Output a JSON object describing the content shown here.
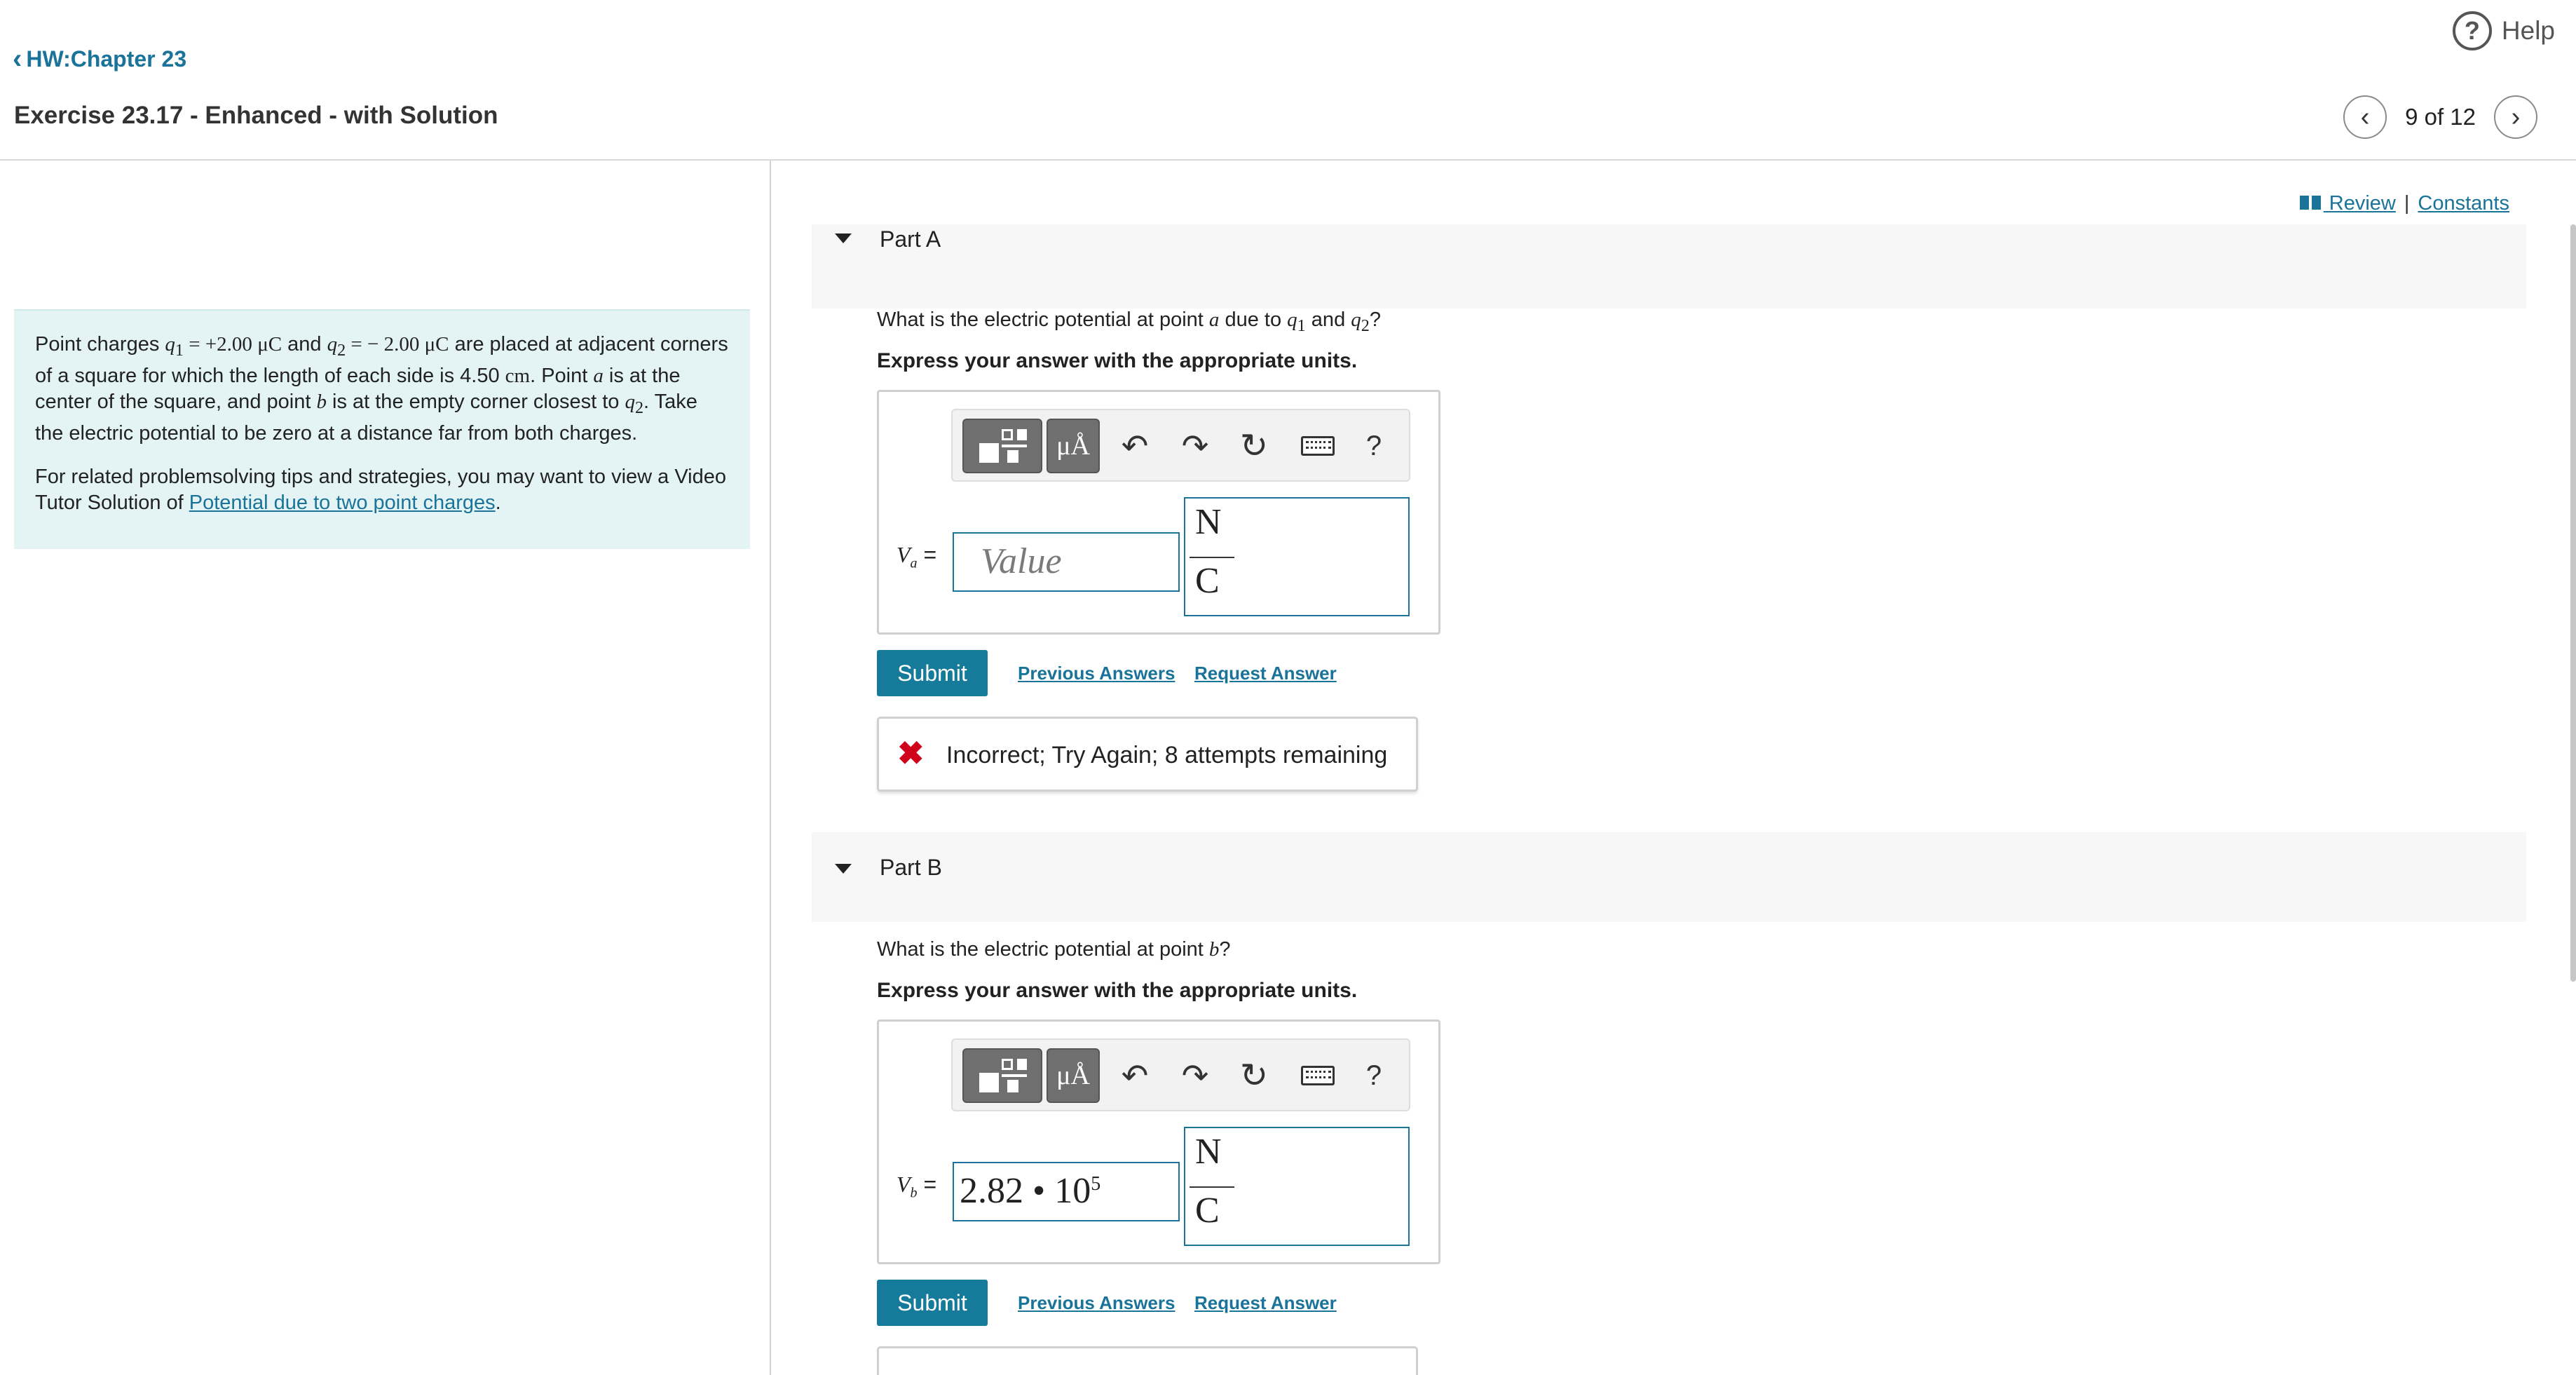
{
  "header": {
    "help_label": "Help",
    "help_icon": "?",
    "back_label": "HW:Chapter 23",
    "title": "Exercise 23.17 - Enhanced - with Solution",
    "pager": "9 of 12",
    "prev_icon": "‹",
    "next_icon": "›"
  },
  "problem": {
    "intro_1": "Point charges ",
    "q1_sym": "q",
    "q1_sub": "1",
    "q1_val": " = +2.00 ",
    "unit_mu": "μC",
    "and": " and ",
    "q2_sym": "q",
    "q2_sub": "2",
    "q2_val": " = − 2.00 ",
    "intro_2": " are placed at adjacent corners of a square for which the length of each side is 4.50 ",
    "cm": "cm",
    "intro_3": ". Point ",
    "a": "a",
    "intro_4": " is at the center of the square, and point ",
    "b": "b",
    "intro_5": " is at the empty corner closest to ",
    "intro_6": ". Take the electric potential to be zero at a distance far from both charges.",
    "tips_1": "For related problemsolving tips and strategies, you may want to view a Video Tutor Solution of ",
    "tips_link": "Potential due to two point charges",
    "tips_2": "."
  },
  "links": {
    "review": " Review",
    "sep": "|",
    "constants": "Constants"
  },
  "partA": {
    "title": "Part A",
    "question_1": "What is the electric potential at point ",
    "question_2": " due to ",
    "question_3": " and ",
    "question_4": "?",
    "express": "Express your answer with the appropriate units.",
    "var_label": "V",
    "var_sub": "a",
    "eq": " =",
    "value_placeholder": "Value",
    "unit_num": "N",
    "unit_den": "C",
    "submit": "Submit",
    "previous": "Previous Answers",
    "request": "Request Answer",
    "feedback": "Incorrect; Try Again; 8 attempts remaining",
    "feedback_icon": "✖"
  },
  "partB": {
    "title": "Part B",
    "question_1": "What is the electric potential at point ",
    "question_2": "?",
    "express": "Express your answer with the appropriate units.",
    "var_label": "V",
    "var_sub": "b",
    "eq": " =",
    "value_mantissa": "2.82 • 10",
    "value_exp": "5",
    "unit_num": "N",
    "unit_den": "C",
    "submit": "Submit",
    "previous": "Previous Answers",
    "request": "Request Answer"
  },
  "toolbar": {
    "mu_label": "μÅ",
    "undo_icon": "↶",
    "redo_icon": "↷",
    "reset_icon": "↻",
    "help_label": "?"
  },
  "colors": {
    "link": "#1a7399",
    "submit_bg": "#167a9a",
    "error": "#d0021b",
    "problem_bg": "#e4f4f4"
  }
}
